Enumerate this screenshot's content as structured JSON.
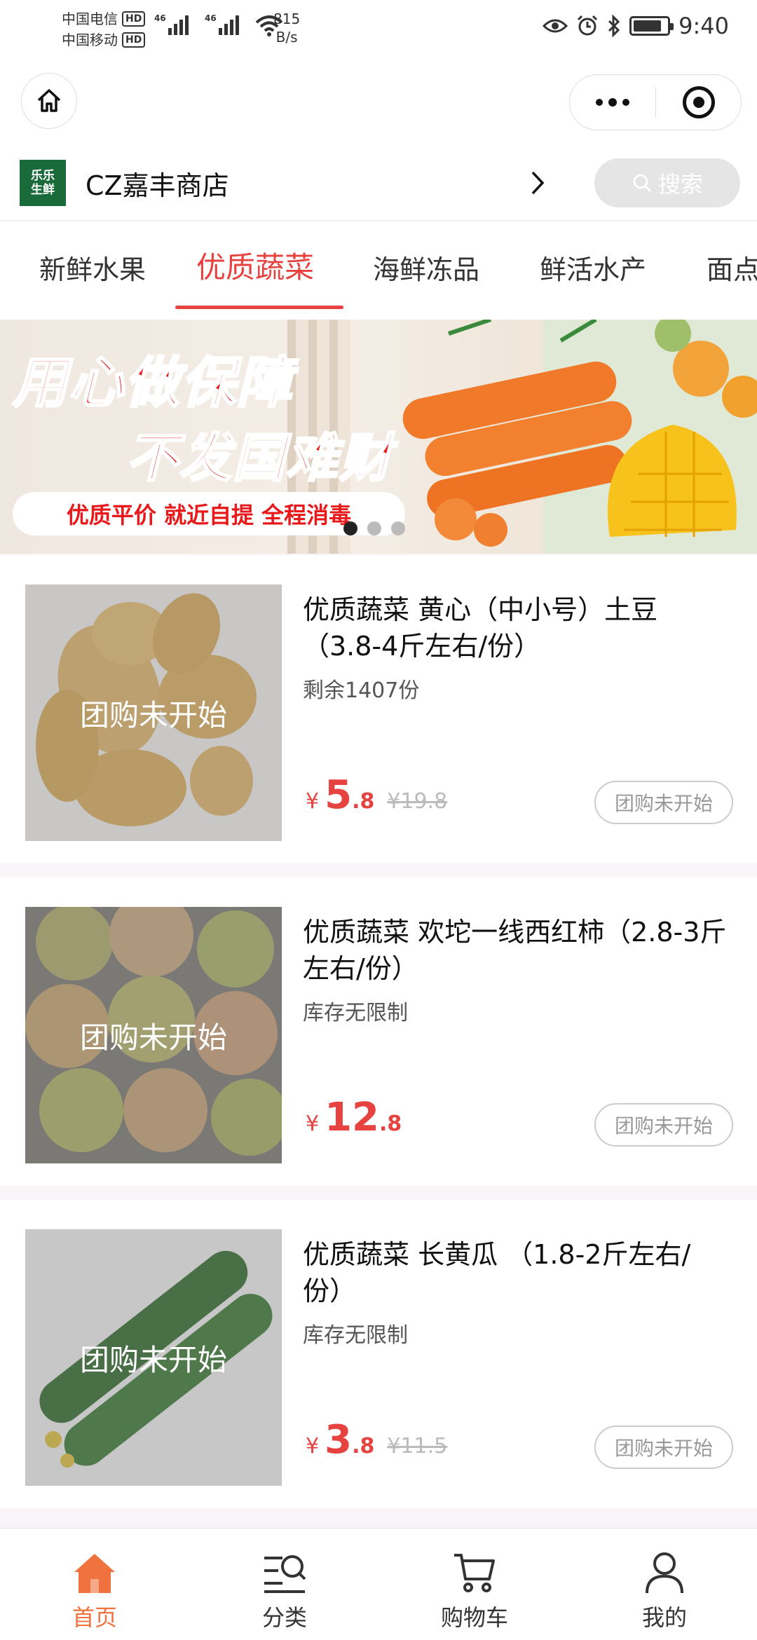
{
  "status_bar": {
    "carrier1": "中国电信",
    "carrier2": "中国移动",
    "hd": "HD",
    "net": "46",
    "speed_value": "815",
    "speed_unit": "B/s",
    "time": "9:40",
    "battery_level": 0.85
  },
  "store": {
    "logo_line1": "乐乐",
    "logo_line2": "生鲜",
    "name": "CZ嘉丰商店",
    "search_label": "搜索"
  },
  "tabs": [
    "新鲜水果",
    "优质蔬菜",
    "海鲜冻品",
    "鲜活水产",
    "面点"
  ],
  "active_tab_index": 1,
  "banner": {
    "line1": "用心做保障",
    "line2": "不发国难财",
    "tagline": "优质平价  就近自提  全程消毒",
    "slide_count": 3,
    "active_slide": 0
  },
  "products": [
    {
      "title": "优质蔬菜 黄心（中小号）土豆（3.8-4斤左右/份）",
      "stock": "剩余1407份",
      "currency": "¥",
      "price_int": "5",
      "price_dec": ".8",
      "orig_price": "¥19.8",
      "overlay": "团购未开始",
      "button": "团购未开始",
      "image": "potato-image"
    },
    {
      "title": "优质蔬菜 欢坨一线西红柿（2.8-3斤左右/份）",
      "stock": "库存无限制",
      "currency": "¥",
      "price_int": "12",
      "price_dec": ".8",
      "orig_price": "",
      "overlay": "团购未开始",
      "button": "团购未开始",
      "image": "tomato-image"
    },
    {
      "title": "优质蔬菜 长黄瓜 （1.8-2斤左右/份）",
      "stock": "库存无限制",
      "currency": "¥",
      "price_int": "3",
      "price_dec": ".8",
      "orig_price": "¥11.5",
      "overlay": "团购未开始",
      "button": "团购未开始",
      "image": "cucumber-image"
    }
  ],
  "tabbar": [
    {
      "label": "首页",
      "icon": "home-icon",
      "active": true
    },
    {
      "label": "分类",
      "icon": "category-search-icon",
      "active": false
    },
    {
      "label": "购物车",
      "icon": "cart-icon",
      "active": false
    },
    {
      "label": "我的",
      "icon": "profile-icon",
      "active": false
    }
  ],
  "colors": {
    "accent": "#e64340",
    "tabbar_active": "#f0733f",
    "logo_bg": "#1a6b3b"
  }
}
